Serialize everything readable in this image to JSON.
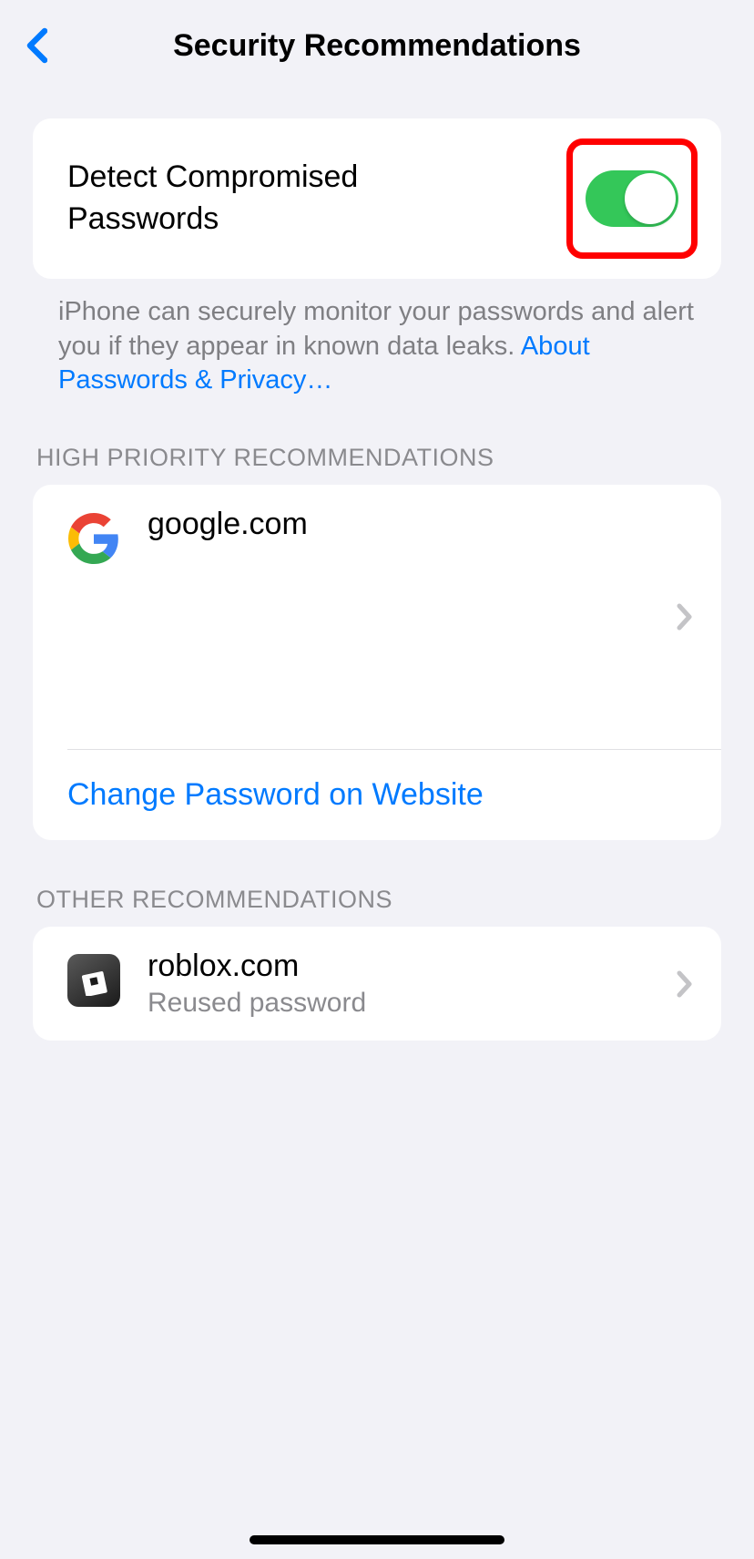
{
  "header": {
    "title": "Security Recommendations"
  },
  "detect": {
    "label": "Detect Compromised Passwords",
    "footer": "iPhone can securely monitor your passwords and alert you if they appear in known data leaks.",
    "link": "About Passwords & Privacy…"
  },
  "sections": {
    "high_priority": {
      "header": "HIGH PRIORITY RECOMMENDATIONS",
      "item": {
        "site": "google.com",
        "action": "Change Password on Website"
      }
    },
    "other": {
      "header": "OTHER RECOMMENDATIONS",
      "item": {
        "site": "roblox.com",
        "detail": "Reused password"
      }
    }
  }
}
